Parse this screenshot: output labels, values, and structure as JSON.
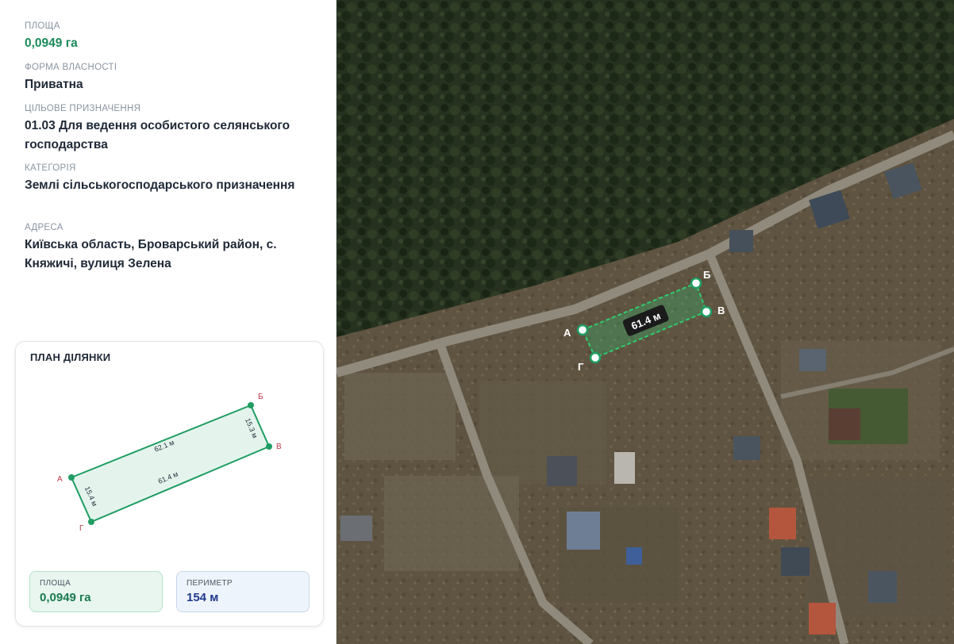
{
  "info": {
    "area": {
      "label": "ПЛОЩА",
      "value": "0,0949 га"
    },
    "ownership": {
      "label": "ФОРМА ВЛАСНОСТІ",
      "value": "Приватна"
    },
    "purpose": {
      "label": "ЦІЛЬОВЕ ПРИЗНАЧЕННЯ",
      "value": "01.03 Для ведення особистого селянського господарства"
    },
    "category": {
      "label": "КАТЕГОРІЯ",
      "value": "Землі сільськогосподарського призначення"
    },
    "address": {
      "label": "АДРЕСА",
      "value": "Київська область, Броварський район, с. Княжичі, вулиця Зелена"
    }
  },
  "plan": {
    "title": "ПЛАН ДІЛЯНКИ",
    "points": {
      "a": "А",
      "b": "Б",
      "v": "В",
      "g": "Г"
    },
    "sides": {
      "ab": "62.1 м",
      "bv": "15.3 м",
      "vg": "61.4 м",
      "ga": "15.4 м"
    },
    "stats": {
      "area": {
        "label": "ПЛОЩА",
        "value": "0,0949 га"
      },
      "perimeter": {
        "label": "ПЕРИМЕТР",
        "value": "154 м"
      }
    }
  },
  "map": {
    "measure_label": "61.4 м",
    "points": {
      "a": "А",
      "b": "Б",
      "v": "В",
      "g": "Г"
    }
  },
  "colors": {
    "accent_green": "#1a8a5a",
    "parcel_stroke": "#1f9d63",
    "point_label": "#c0394b"
  }
}
